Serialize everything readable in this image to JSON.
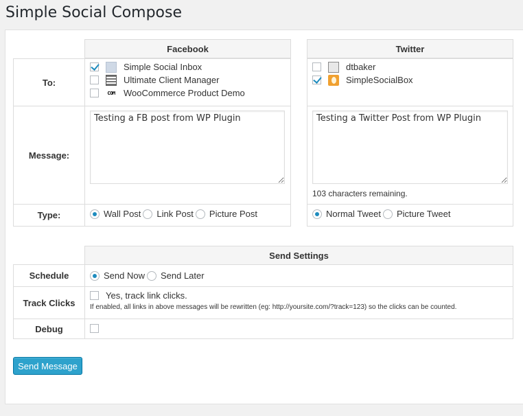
{
  "page": {
    "title": "Simple Social Compose"
  },
  "compose": {
    "facebook_header": "Facebook",
    "twitter_header": "Twitter",
    "to_label": "To:",
    "message_label": "Message:",
    "type_label": "Type:",
    "facebook_accounts": [
      {
        "name": "Simple Social Inbox",
        "checked": true,
        "icon": "page-icon"
      },
      {
        "name": "Ultimate Client Manager",
        "checked": false,
        "icon": "page-icon"
      },
      {
        "name": "WooCommerce Product Demo",
        "checked": false,
        "icon": "page-icon",
        "icon_text": "COM"
      }
    ],
    "twitter_accounts": [
      {
        "name": "dtbaker",
        "checked": false,
        "icon": "avatar-icon"
      },
      {
        "name": "SimpleSocialBox",
        "checked": true,
        "icon": "egg-avatar-icon"
      }
    ],
    "facebook_message": "Testing a FB post from WP Plugin",
    "twitter_message": "Testing a Twitter Post from WP Plugin",
    "twitter_remaining": "103 characters remaining.",
    "facebook_types": [
      {
        "label": "Wall Post",
        "checked": true
      },
      {
        "label": "Link Post",
        "checked": false
      },
      {
        "label": "Picture Post",
        "checked": false
      }
    ],
    "twitter_types": [
      {
        "label": "Normal Tweet",
        "checked": true
      },
      {
        "label": "Picture Tweet",
        "checked": false
      }
    ]
  },
  "send_settings": {
    "header": "Send Settings",
    "schedule_label": "Schedule",
    "schedule_options": [
      {
        "label": "Send Now",
        "checked": true
      },
      {
        "label": "Send Later",
        "checked": false
      }
    ],
    "track_label": "Track Clicks",
    "track_checkbox_label": "Yes, track link clicks.",
    "track_checked": false,
    "track_note": "If enabled, all links in above messages will be rewritten (eg: http://yoursite.com/?track=123) so the clicks can be counted.",
    "debug_label": "Debug",
    "debug_checked": false
  },
  "actions": {
    "send_label": "Send Message"
  },
  "colors": {
    "primary_button": "#2ea2cc",
    "accent": "#1e8cbe"
  }
}
